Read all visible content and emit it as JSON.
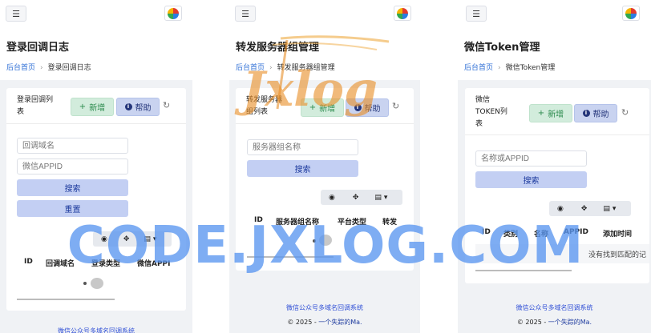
{
  "common": {
    "breadcrumb_home": "后台首页",
    "add_label": "新增",
    "help_label": "帮助",
    "search_label": "搜索",
    "footer_link": "微信公众号多域名回调系统",
    "footer_copy_prefix": "© 2025 - ",
    "footer_copy_author": "一个失踪的Ma."
  },
  "panel1": {
    "title": "登录回调日志",
    "breadcrumb_current": "登录回调日志",
    "card_title_lines": [
      "登录回调列",
      "表"
    ],
    "filter_domain_placeholder": "回调域名",
    "filter_appid_placeholder": "微信APPID",
    "reset_label": "重置",
    "columns": [
      "ID",
      "回调域名",
      "登录类型",
      "微信APPI"
    ]
  },
  "panel2": {
    "title": "转发服务器组管理",
    "breadcrumb_current": "转发服务器组管理",
    "card_title_lines": [
      "转发服务器",
      "组列表"
    ],
    "filter_name_placeholder": "服务器组名称",
    "columns": [
      "ID",
      "服务器组名称",
      "平台类型",
      "转发"
    ]
  },
  "panel3": {
    "title": "微信Token管理",
    "breadcrumb_current": "微信Token管理",
    "card_title_lines": [
      "微信",
      "TOKEN列",
      "表"
    ],
    "filter_placeholder": "名称或APPID",
    "columns": [
      "ID",
      "类别",
      "名称",
      "APPID",
      "添加时间"
    ],
    "empty_text": "没有找到匹配的记"
  },
  "watermark": {
    "logo_text": "Jxlog",
    "text": "CODE.JXLOG.COM"
  },
  "colors": {
    "accent_blue": "#2f6fd6",
    "add_green_bg": "#d2ecdc",
    "help_blue_bg": "#c9d3f0",
    "search_bg": "#c3cff3",
    "watermark_blue": "#5a96f0",
    "logo_orange": "#e8902a"
  },
  "icons": [
    "menu-icon",
    "app-logo-icon",
    "plus-icon",
    "info-icon",
    "refresh-icon",
    "eye-icon",
    "move-icon",
    "columns-icon",
    "chevron-down-icon"
  ]
}
